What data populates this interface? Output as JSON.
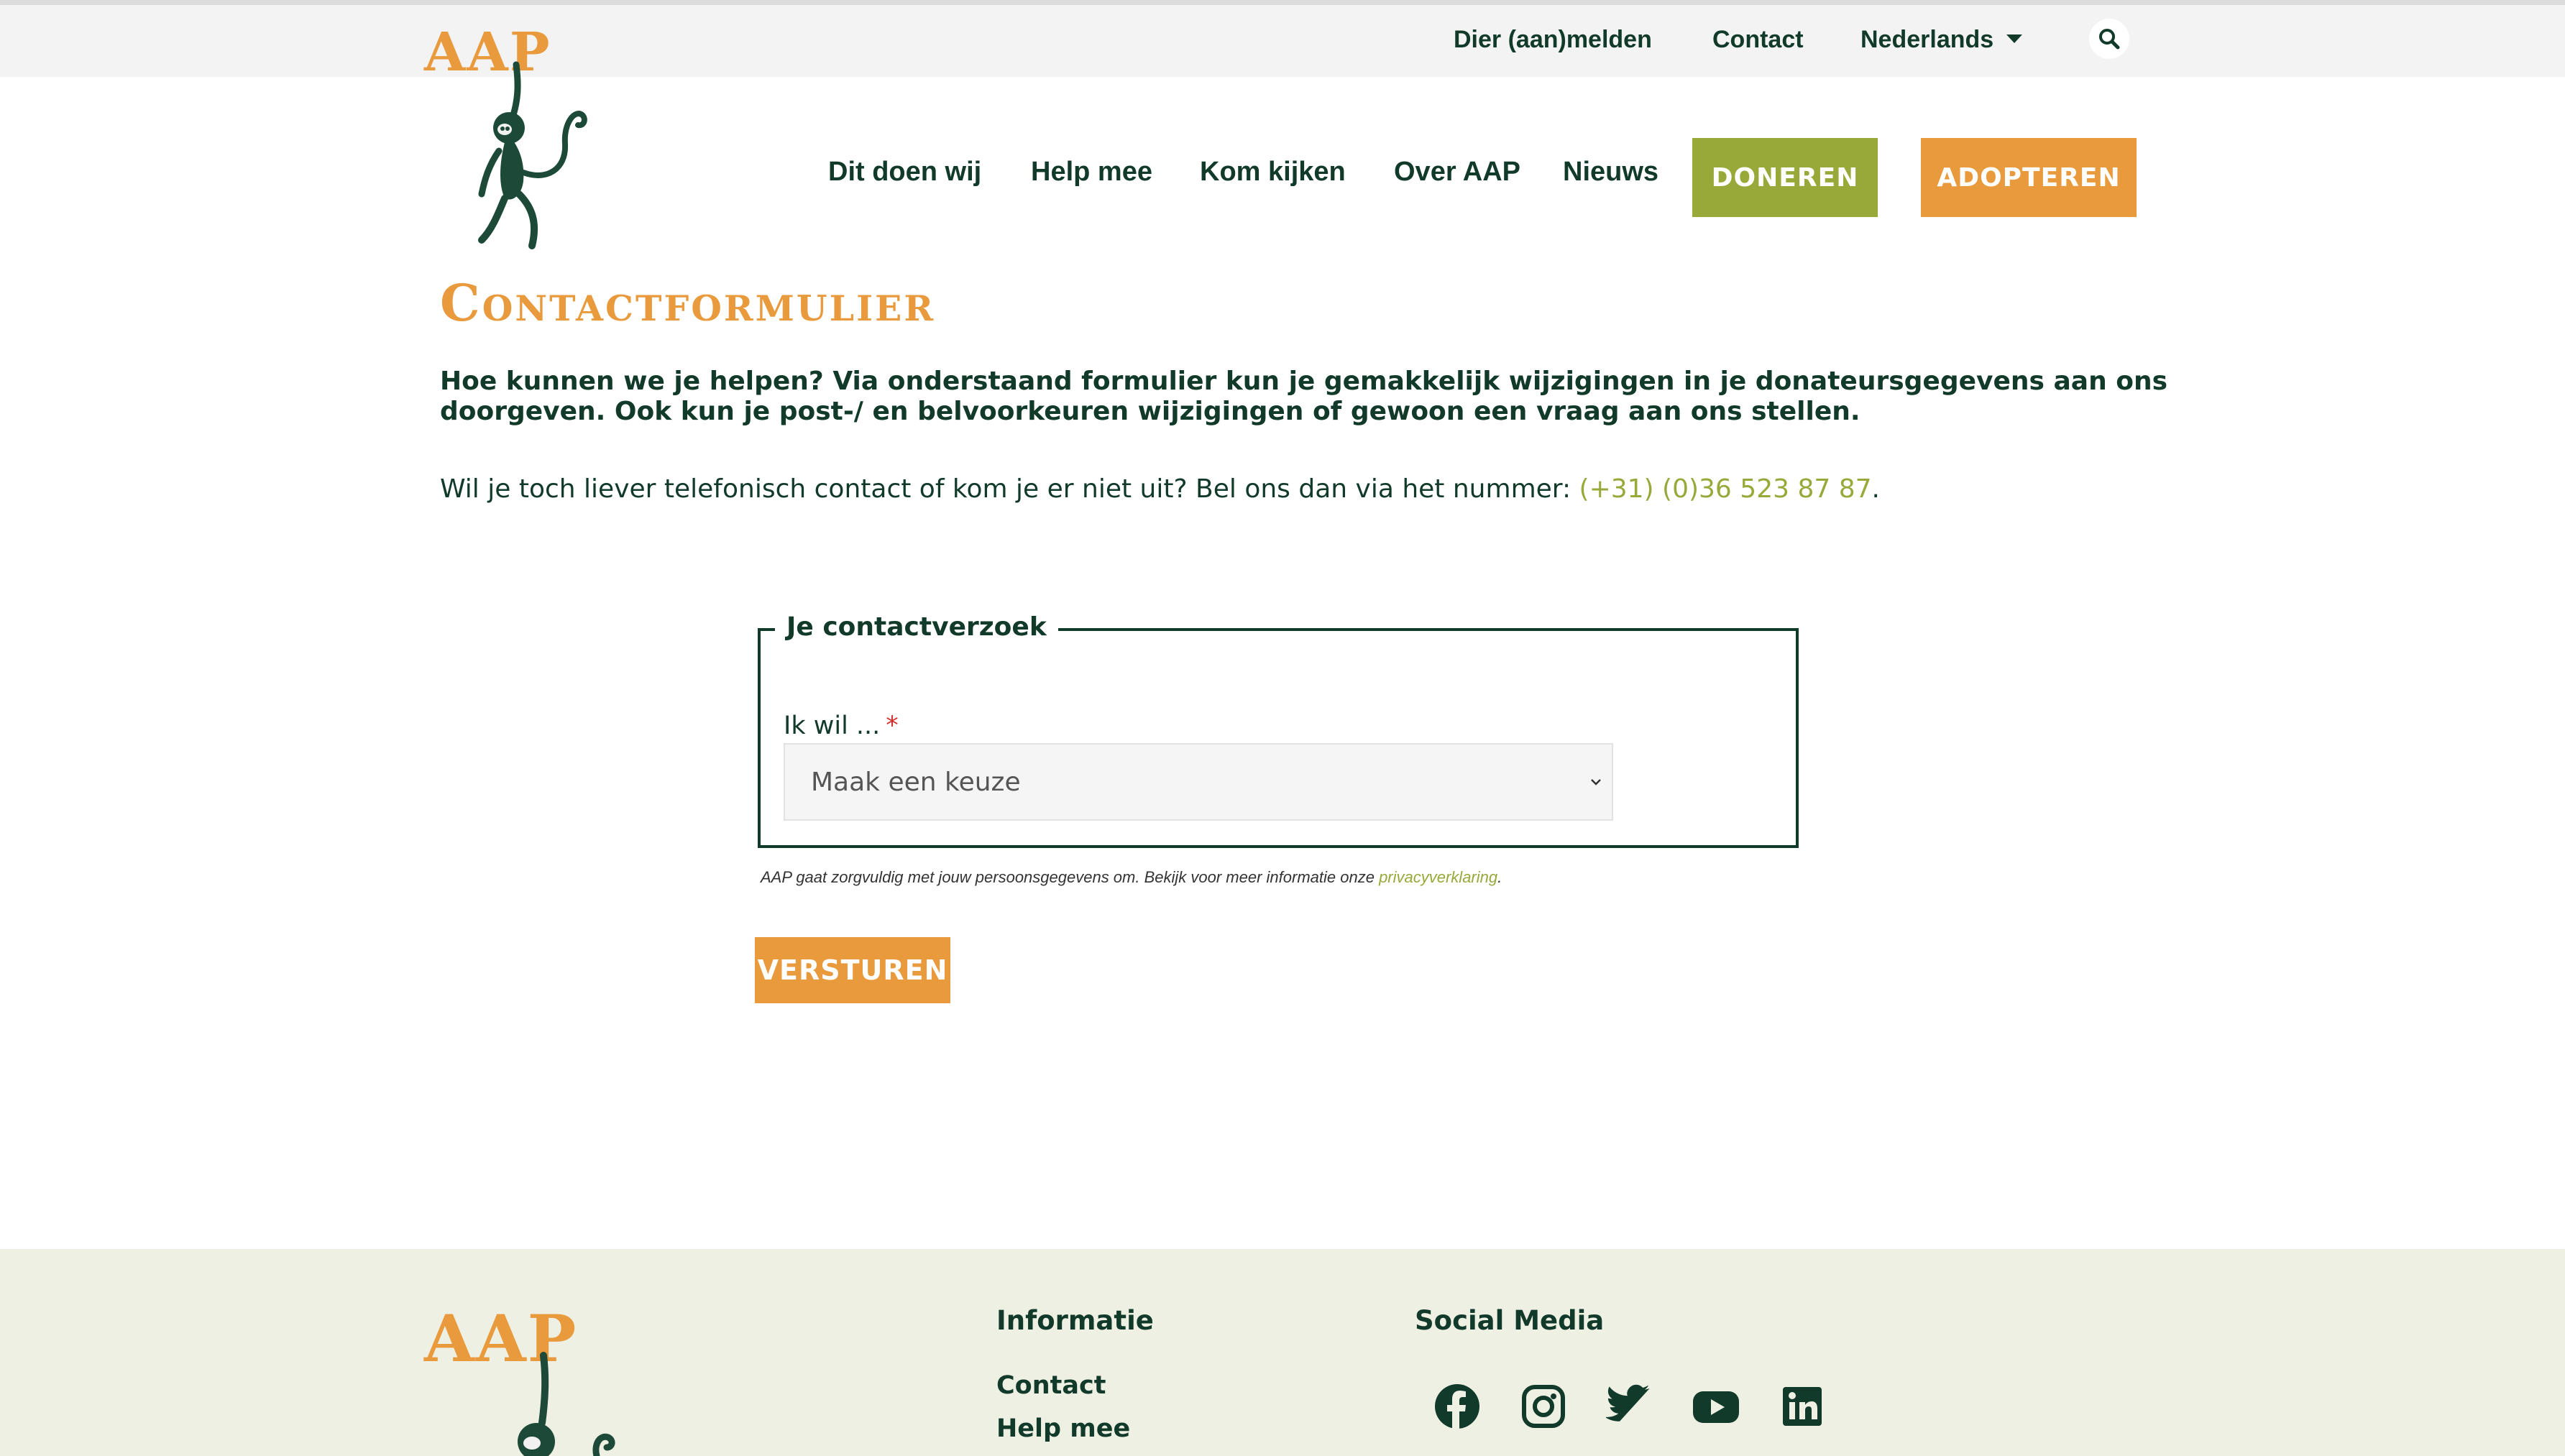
{
  "topbar": {
    "links": [
      "Dier (aan)melden",
      "Contact"
    ],
    "language": "Nederlands"
  },
  "logo": {
    "text": "AAP"
  },
  "nav": {
    "items": [
      "Dit doen wij",
      "Help mee",
      "Kom kijken",
      "Over AAP",
      "Nieuws"
    ],
    "donate": "DONEREN",
    "adopt": "ADOPTEREN"
  },
  "page": {
    "title": "Contactformulier",
    "intro": "Hoe kunnen we je helpen? Via onderstaand formulier kun je gemakkelijk wijzigingen in je donateursgegevens aan ons doorgeven. Ook kun je post-/ en belvoorkeuren wijzigingen of gewoon een vraag aan ons stellen.",
    "phone_prefix": "Wil je toch liever telefonisch contact of kom je er niet uit? Bel ons dan via het nummer: ",
    "phone_number": "(+31) (0)36 523 87 87",
    "phone_suffix": "."
  },
  "form": {
    "legend": "Je contactverzoek",
    "label": "Ik wil ...",
    "required_mark": "*",
    "select_value": "Maak een keuze",
    "privacy_text": "AAP gaat zorgvuldig met jouw persoonsgegevens om. Bekijk voor meer informatie onze ",
    "privacy_link": "privacyverklaring",
    "privacy_end": ".",
    "submit": "VERSTUREN"
  },
  "footer": {
    "info_heading": "Informatie",
    "info_links": [
      "Contact",
      "Help mee"
    ],
    "social_heading": "Social Media",
    "social_icons": [
      "facebook-icon",
      "instagram-icon",
      "twitter-icon",
      "youtube-icon",
      "linkedin-icon"
    ]
  },
  "colors": {
    "brand_orange": "#e89a3c",
    "brand_green": "#98a93a",
    "dark_green": "#123a2a",
    "footer_bg": "#eef0e3"
  }
}
